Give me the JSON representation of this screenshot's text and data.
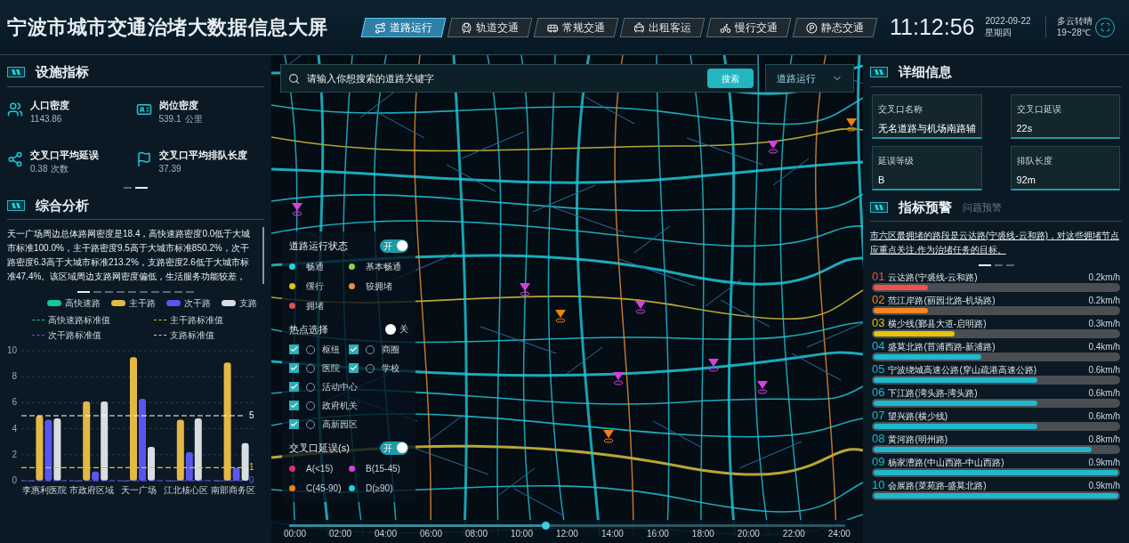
{
  "header": {
    "title": "宁波市城市交通治堵大数据信息大屏",
    "tabs": [
      {
        "label": "道路运行",
        "selected": true
      },
      {
        "label": "轨道交通",
        "selected": false
      },
      {
        "label": "常规交通",
        "selected": false
      },
      {
        "label": "出租客运",
        "selected": false
      },
      {
        "label": "慢行交通",
        "selected": false
      },
      {
        "label": "静态交通",
        "selected": false
      }
    ],
    "time": "11:12:56",
    "date": "2022-09-22",
    "weekday": "星期四",
    "weather": "多云转晴",
    "temperature": "19~28℃"
  },
  "facilities": {
    "title": "设施指标",
    "metrics": [
      {
        "label": "人口密度",
        "value": "1143.86"
      },
      {
        "label": "岗位密度",
        "value": "539.1",
        "unit": "公里"
      },
      {
        "label": "交叉口平均延误",
        "value": "0.38",
        "unit": "次数"
      },
      {
        "label": "交叉口平均排队长度",
        "value": "37.39"
      }
    ],
    "pages": [
      {
        "selected": false
      },
      {
        "selected": true
      }
    ]
  },
  "analysis": {
    "title": "综合分析",
    "text": "天一广场周边总体路网密度是18.4，高快速路密度0.0低于大城市标准100.0%，主干路密度9.5高于大城市标准850.2%，次干路密度6.3高于大城市标准213.2%，支路密度2.6低于大城市标准47.4%。该区域周边支路网密度偏低，生活服务功能较差，",
    "pages": [
      {
        "selected": true
      },
      {
        "selected": false
      },
      {
        "selected": false
      },
      {
        "selected": false
      },
      {
        "selected": false
      },
      {
        "selected": false
      },
      {
        "selected": false
      },
      {
        "selected": false
      },
      {
        "selected": false
      },
      {
        "selected": false
      }
    ],
    "line_legend": [
      {
        "label": "高快速路标准值",
        "color": "#19c59a"
      },
      {
        "label": "主干路标准值",
        "color": "#e3b845"
      },
      {
        "label": "次干路标准值",
        "color": "#5a55f0"
      },
      {
        "label": "支路标准值",
        "color": "#c8ccd2"
      }
    ],
    "chart_data": {
      "type": "bar",
      "categories": [
        "李惠利医院",
        "市政府区域",
        "天一广场",
        "江北核心区",
        "南部商务区"
      ],
      "series": [
        {
          "name": "高快速路",
          "color": "#19c59a",
          "values": [
            0,
            0,
            0,
            0,
            0
          ]
        },
        {
          "name": "主干路",
          "color": "#e3b845",
          "values": [
            5.0,
            6.1,
            9.5,
            4.7,
            9.1
          ]
        },
        {
          "name": "次干路",
          "color": "#5a55f0",
          "values": [
            4.7,
            0.7,
            6.3,
            2.2,
            1.0
          ]
        },
        {
          "name": "支路",
          "color": "#d8dde2",
          "values": [
            4.8,
            6.1,
            2.6,
            4.8,
            2.9
          ]
        }
      ],
      "ylim": [
        0,
        10
      ],
      "yticks": [
        0,
        2,
        4,
        6,
        8,
        10
      ],
      "grid": true,
      "ref_lines": [
        {
          "axis": "y",
          "value": 5,
          "label": "5"
        },
        {
          "axis": "y",
          "value": 1,
          "label": "1"
        },
        {
          "axis": "y",
          "value": 0,
          "label": "0"
        }
      ]
    }
  },
  "search": {
    "placeholder": "请输入你想搜索的道路关键字",
    "button": "搜索",
    "mode": "道路运行"
  },
  "map_legend": {
    "road_status": {
      "title": "道路运行状态",
      "on": true,
      "label": "开",
      "items": [
        {
          "label": "畅通",
          "color": "#1fd3e0"
        },
        {
          "label": "基本畅通",
          "color": "#8bd14e"
        },
        {
          "label": "缓行",
          "color": "#e8c20c"
        },
        {
          "label": "较拥堵",
          "color": "#e8913a"
        },
        {
          "label": "拥堵",
          "color": "#e0504a"
        }
      ]
    },
    "hotspots": {
      "title": "热点选择",
      "on": false,
      "label": "关",
      "items": [
        {
          "label": "枢纽",
          "checked": true
        },
        {
          "label": "商圈",
          "checked": true
        },
        {
          "label": "医院",
          "checked": true
        },
        {
          "label": "学校",
          "checked": true
        },
        {
          "label": "活动中心",
          "checked": true
        },
        {
          "label": "政府机关",
          "checked": true
        },
        {
          "label": "高新园区",
          "checked": true
        }
      ]
    },
    "delay": {
      "title": "交叉口延误(s)",
      "on": true,
      "label": "开",
      "items": [
        {
          "label": "A(<15)",
          "color": "#e0306a"
        },
        {
          "label": "B(15-45)",
          "color": "#d83ee0"
        },
        {
          "label": "C(45-90)",
          "color": "#f0820a"
        },
        {
          "label": "D(≥90)",
          "color": "#1fd3e0"
        }
      ]
    }
  },
  "timeline": {
    "labels": [
      "00:00",
      "02:00",
      "04:00",
      "06:00",
      "08:00",
      "10:00",
      "12:00",
      "14:00",
      "16:00",
      "18:00",
      "20:00",
      "22:00",
      "24:00"
    ],
    "level": 0.46
  },
  "details": {
    "title": "详细信息",
    "cards": [
      {
        "label": "交叉口名称",
        "value": "无名道路与机场南路辅"
      },
      {
        "label": "交叉口延误",
        "value": "22s"
      },
      {
        "label": "延误等级",
        "value": "B"
      },
      {
        "label": "排队长度",
        "value": "92m"
      }
    ]
  },
  "warnings": {
    "tabs": [
      {
        "label": "指标预警",
        "selected": true
      },
      {
        "label": "问题预警",
        "selected": false
      }
    ],
    "text": "市六区最拥堵的路段是云达路(宁裘线-云和路)，对这些拥堵节点应重点关注,作为治堵任务的目标。",
    "pages": [
      {
        "selected": true
      },
      {
        "selected": false
      },
      {
        "selected": false
      }
    ],
    "ranking": [
      {
        "rank": "01",
        "road": "云达路(宁裘线-云和路)",
        "speed": "0.2km/h",
        "level": 0.22,
        "color": "#f0524a"
      },
      {
        "rank": "02",
        "road": "范江岸路(丽园北路-机场路)",
        "speed": "0.2km/h",
        "level": 0.22,
        "color": "#f7861e"
      },
      {
        "rank": "03",
        "road": "横少线(鄞县大道-启明路)",
        "speed": "0.3km/h",
        "level": 0.33,
        "color": "#e8c20c"
      },
      {
        "rank": "04",
        "road": "盛莫北路(苜浦西路-新浦路)",
        "speed": "0.4km/h",
        "level": 0.44,
        "color": "#1fb8cc"
      },
      {
        "rank": "05",
        "road": "宁波绕城高速公路(穿山疏港高速公路)",
        "speed": "0.6km/h",
        "level": 0.67,
        "color": "#1fb8cc"
      },
      {
        "rank": "06",
        "road": "下江路(湾头路-湾头路)",
        "speed": "0.6km/h",
        "level": 0.67,
        "color": "#1fb8cc"
      },
      {
        "rank": "07",
        "road": "望兴路(横少线)",
        "speed": "0.6km/h",
        "level": 0.67,
        "color": "#1fb8cc"
      },
      {
        "rank": "08",
        "road": "黄河路(明州路)",
        "speed": "0.8km/h",
        "level": 0.89,
        "color": "#1fb8cc"
      },
      {
        "rank": "09",
        "road": "杨家漕路(中山西路-中山西路)",
        "speed": "0.9km/h",
        "level": 1.0,
        "color": "#1fb8cc"
      },
      {
        "rank": "10",
        "road": "会展路(菜苑路-盛莫北路)",
        "speed": "0.9km/h",
        "level": 1.0,
        "color": "#1fb8cc"
      }
    ]
  }
}
